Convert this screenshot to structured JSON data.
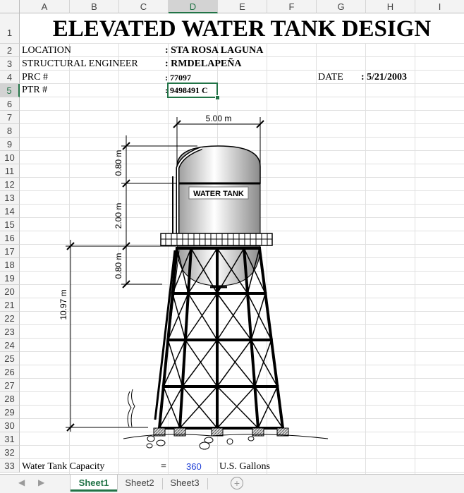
{
  "columns": [
    "A",
    "B",
    "C",
    "D",
    "E",
    "F",
    "G",
    "H",
    "I"
  ],
  "rows": [
    "1",
    "2",
    "3",
    "4",
    "5",
    "6",
    "7",
    "8",
    "9",
    "10",
    "11",
    "12",
    "13",
    "14",
    "15",
    "16",
    "17",
    "18",
    "19",
    "20",
    "21",
    "22",
    "23",
    "24",
    "25",
    "26",
    "27",
    "28",
    "29",
    "30",
    "31",
    "32",
    "33"
  ],
  "selected_column": "D",
  "selected_row": "5",
  "title": "ELEVATED WATER TANK DESIGN",
  "info": {
    "location_label": "LOCATION",
    "location_value": ": STA ROSA LAGUNA",
    "engineer_label": "STRUCTURAL ENGINEER",
    "engineer_value": ": RMDELAPEÑA",
    "prc_label": "PRC #",
    "prc_value": ": 77097",
    "date_label": "DATE",
    "date_value": ": 5/21/2003",
    "ptr_label": "PTR #",
    "ptr_value": ": 9498491 C"
  },
  "drawing": {
    "tank_label": "WATER TANK",
    "dim_width": "5.00 m",
    "dim_roof": "0.80 m",
    "dim_body": "2.00 m",
    "dim_bottom": "0.80 m",
    "dim_tower": "10.97 m"
  },
  "capacity": {
    "label": "Water Tank Capacity",
    "equals": "=",
    "value": "360",
    "unit": "U.S. Gallons",
    "value_color": "#1f3fd6"
  },
  "tabs": [
    {
      "label": "Sheet1",
      "active": true
    },
    {
      "label": "Sheet2",
      "active": false
    },
    {
      "label": "Sheet3",
      "active": false
    }
  ],
  "accent_color": "#217346"
}
